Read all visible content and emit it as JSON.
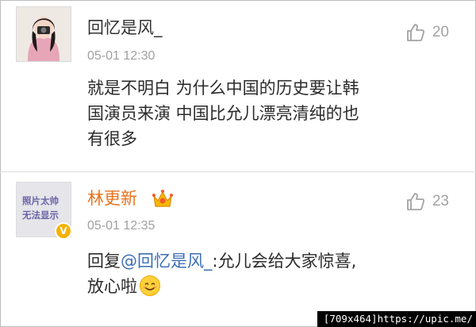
{
  "comments": [
    {
      "username": "回忆是风_",
      "timestamp": "05-01 12:30",
      "likes": "20",
      "text_lines": [
        "就是不明白 为什么中国的历史要让韩",
        "国演员来演 中国比允儿漂亮清纯的也",
        "有很多"
      ]
    },
    {
      "username": "林更新",
      "timestamp": "05-01 12:35",
      "likes": "23",
      "reply_prefix": "回复",
      "mention": "@回忆是风_",
      "reply_rest": ":允儿会给大家惊喜,",
      "reply_line2": "放心啦",
      "avatar_placeholder_line1": "照片太帅",
      "avatar_placeholder_line2": "无法显示",
      "badge": "V"
    }
  ],
  "watermark": "[709x464]https://upic.me/",
  "colors": {
    "username_verified": "#e8731e",
    "mention": "#3d6fb6",
    "timestamp": "#a0a0a0",
    "badge": "#f6b100"
  },
  "icons": [
    "thumbs-up-icon",
    "crown-icon",
    "verified-badge-icon",
    "smiley-emoji-icon"
  ]
}
